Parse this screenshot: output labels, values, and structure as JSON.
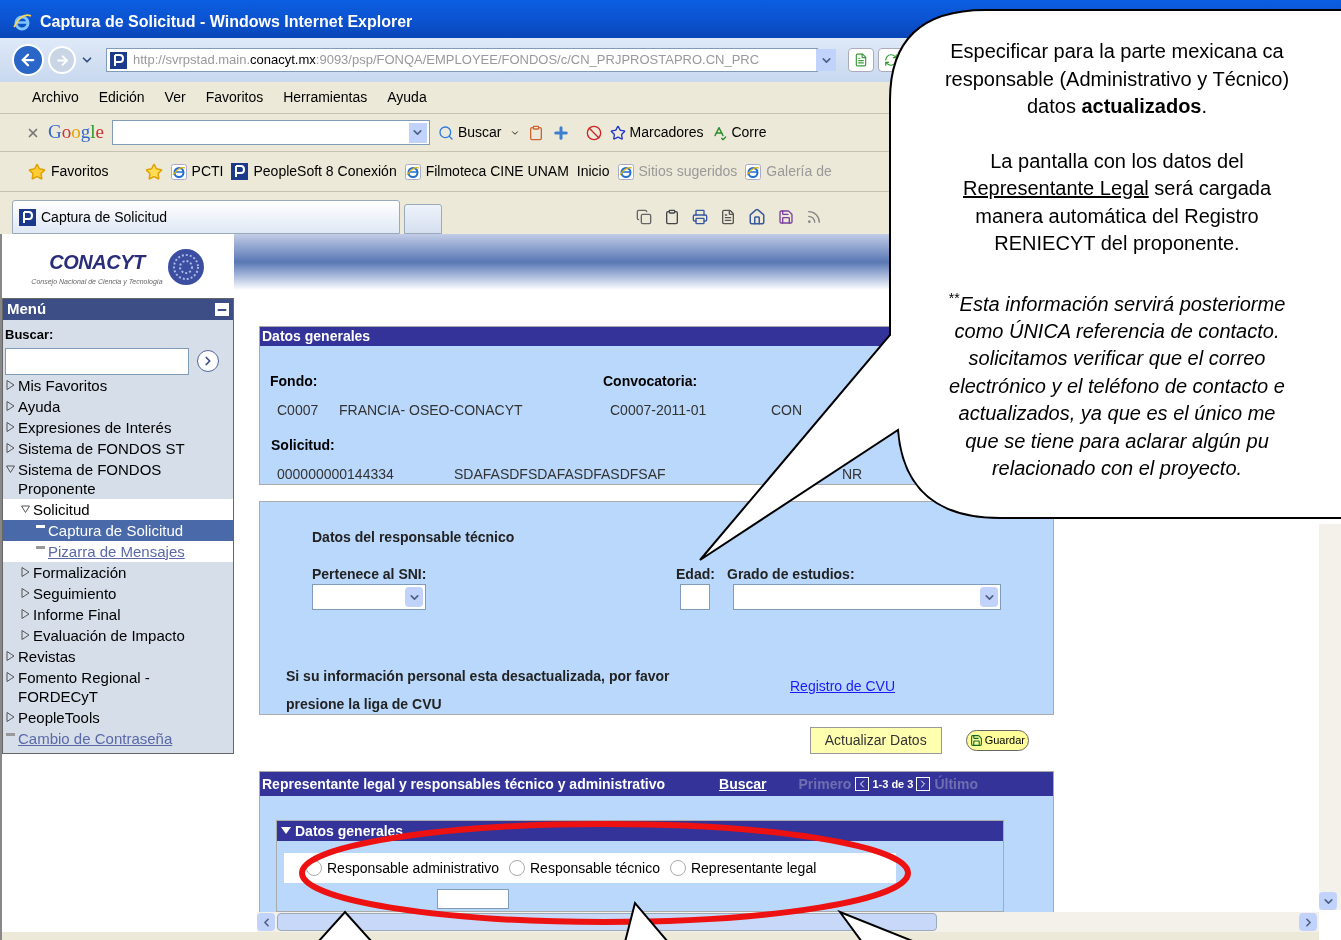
{
  "window": {
    "title": "Captura de Solicitud - Windows Internet Explorer"
  },
  "address_bar": {
    "prefix": "http://svrpstad.main.",
    "domain": "conacyt.mx",
    "suffix": ":9093/psp/FONQA/EMPLOYEE/FONDOS/c/CN_PRJPROSTAPRO.CN_PRC"
  },
  "menu_bar": [
    "Archivo",
    "Edición",
    "Ver",
    "Favoritos",
    "Herramientas",
    "Ayuda"
  ],
  "google_toolbar": {
    "logo": "Google",
    "buttons": [
      {
        "label": "Buscar",
        "kind": "search"
      },
      {
        "label": "Marcadores",
        "kind": "bookmarks"
      },
      {
        "label": "Corre",
        "kind": "spell"
      }
    ]
  },
  "favorites_bar": {
    "favorites": "Favoritos",
    "links": [
      {
        "label": "PCTI",
        "kind": "ie",
        "dimmed": false
      },
      {
        "label": "PeopleSoft 8 Conexión",
        "kind": "peoplesoft",
        "dimmed": false
      },
      {
        "label": "Filmoteca CINE UNAM",
        "kind": "ie",
        "dimmed": false
      },
      {
        "label": "Inicio",
        "kind": "plain",
        "dimmed": false
      },
      {
        "label": "Sitios sugeridos",
        "kind": "ie",
        "dimmed": true
      },
      {
        "label": "Galería de",
        "kind": "ie",
        "dimmed": true
      }
    ]
  },
  "tabs": [
    {
      "label": "Captura de Solicitud",
      "selected": true
    }
  ],
  "sidebar": {
    "logo": {
      "name": "CONACYT",
      "tagline": "Consejo Nacional de Ciencia y Tecnología"
    },
    "menu_title": "Menú",
    "search_label": "Buscar:",
    "items": [
      {
        "label": "Mis Favoritos",
        "kind": "folder",
        "expanded": false,
        "selected": false
      },
      {
        "label": "Ayuda",
        "kind": "folder",
        "expanded": false,
        "selected": false
      },
      {
        "label": "Expresiones de Interés",
        "kind": "folder",
        "expanded": false,
        "selected": false
      },
      {
        "label": "Sistema de FONDOS ST",
        "kind": "folder",
        "expanded": false,
        "selected": false
      },
      {
        "label": "Sistema de FONDOS Proponente",
        "kind": "folder",
        "expanded": true,
        "selected": false,
        "children": [
          {
            "label": "Solicitud",
            "kind": "folder",
            "expanded": true,
            "selected": false,
            "children": [
              {
                "label": "Captura de Solicitud",
                "kind": "link",
                "selected": true
              },
              {
                "label": "Pizarra de Mensajes",
                "kind": "link",
                "selected": false
              }
            ]
          },
          {
            "label": "Formalización",
            "kind": "folder",
            "expanded": false,
            "selected": false
          },
          {
            "label": "Seguimiento",
            "kind": "folder",
            "expanded": false,
            "selected": false
          },
          {
            "label": "Informe Final",
            "kind": "folder",
            "expanded": false,
            "selected": false
          },
          {
            "label": "Evaluación de Impacto",
            "kind": "folder",
            "expanded": false,
            "selected": false
          }
        ]
      },
      {
        "label": "Revistas",
        "kind": "folder",
        "expanded": false,
        "selected": false
      },
      {
        "label": "Fomento Regional - FORDECyT",
        "kind": "folder",
        "expanded": false,
        "selected": false
      },
      {
        "label": "PeopleTools",
        "kind": "folder",
        "expanded": false,
        "selected": false
      },
      {
        "label": "Cambio de Contraseña",
        "kind": "link",
        "selected": false
      }
    ]
  },
  "general_data": {
    "title": "Datos generales",
    "fondo": {
      "label": "Fondo:",
      "code": "C0007",
      "name": "FRANCIA- OSEO-CONACYT"
    },
    "convocatoria": {
      "label": "Convocatoria:",
      "value": "C0007-2011-01"
    },
    "column_3": "CON",
    "solicitud": {
      "label": "Solicitud:",
      "number": "000000000144334",
      "name": "SDAFASDFSDAFASDFASDFSAF"
    },
    "column_3_row_2": "NR"
  },
  "technical": {
    "title": "Datos del responsable técnico",
    "sni_label": "Pertenece al SNI:",
    "age_label": "Edad:",
    "degree_label": "Grado de estudios:",
    "notice": "Si su información personal esta desactualizada, por favor presione la liga de CVU",
    "link": "Registro de CVU"
  },
  "buttons": [
    {
      "label": "Actualizar Datos",
      "kind": "plain"
    },
    {
      "label": "Guardar",
      "kind": "save"
    }
  ],
  "representatives": {
    "title": "Representante legal y responsables técnico y administrativo",
    "search_link": "Buscar",
    "pager": {
      "first": {
        "label": "Primero",
        "disabled": true
      },
      "range": "1-3 de 3",
      "last": {
        "label": "Último",
        "disabled": true
      }
    },
    "subsection": {
      "title": "Datos generales",
      "expanded": true
    },
    "roles": [
      {
        "label": "Responsable administrativo",
        "selected": false
      },
      {
        "label": "Responsable técnico",
        "selected": false
      },
      {
        "label": "Representante legal",
        "selected": false
      }
    ]
  },
  "callout": {
    "paragraphs": [
      {
        "kind": "plain",
        "lines": [
          [
            {
              "text": "Especificar para la parte mexicana ca",
              "underline": false
            }
          ],
          [
            {
              "text": "responsable (Administrativo y Técnico)",
              "underline": false
            }
          ],
          [
            {
              "text": "datos **actualizados**.",
              "underline": false
            }
          ]
        ]
      },
      {
        "kind": "plain",
        "lines": [
          [
            {
              "text": "La pantalla con los datos del",
              "underline": false
            }
          ],
          [
            {
              "text": "Representante Legal",
              "underline": true
            },
            {
              "text": " será cargada",
              "underline": false
            }
          ],
          [
            {
              "text": "manera automática del Registro",
              "underline": false
            }
          ],
          [
            {
              "text": "RENIECYT del proponente.",
              "underline": false
            }
          ]
        ]
      },
      {
        "kind": "note",
        "lead": "**",
        "lines": [
          [
            {
              "text": "Esta información servirá posteriorme",
              "underline": false
            }
          ],
          [
            {
              "text": "como ÚNICA referencia de contacto.",
              "underline": false
            }
          ],
          [
            {
              "text": "solicitamos verificar que el correo",
              "underline": false
            }
          ],
          [
            {
              "text": "electrónico y el teléfono de contacto e",
              "underline": false
            }
          ],
          [
            {
              "text": "actualizados, ya que es el único me",
              "underline": false
            }
          ],
          [
            {
              "text": "que se tiene para aclarar algún pu",
              "underline": false
            }
          ],
          [
            {
              "text": "relacionado con el proyecto.",
              "underline": false
            }
          ]
        ]
      }
    ]
  }
}
